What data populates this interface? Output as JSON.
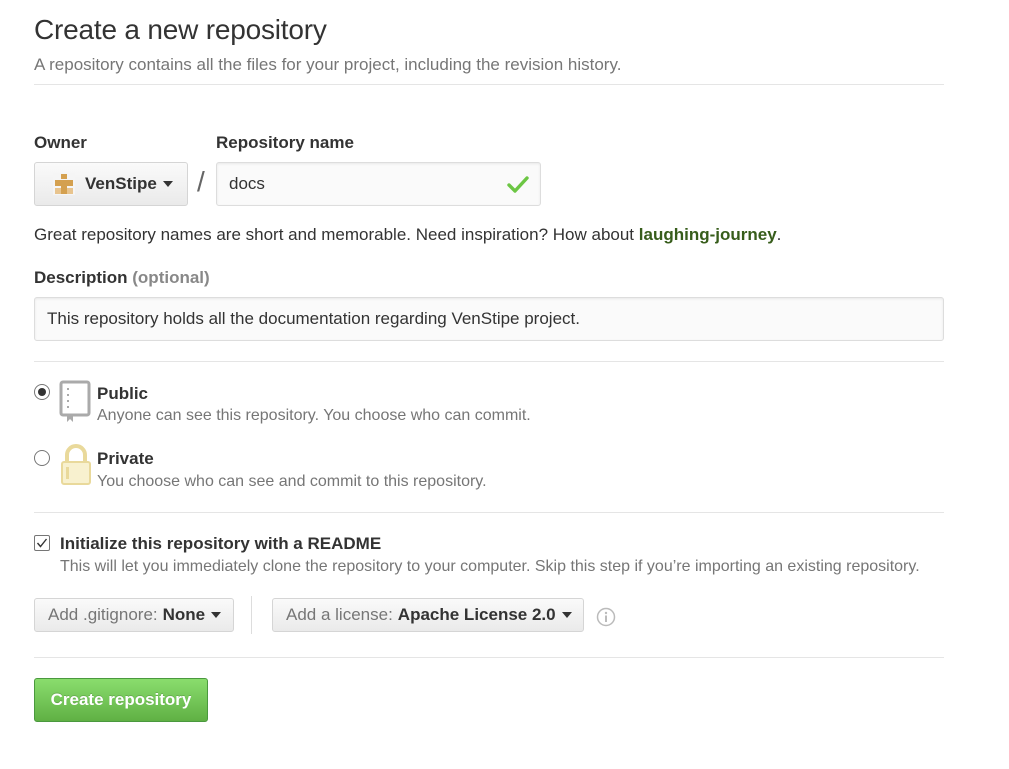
{
  "header": {
    "title": "Create a new repository",
    "subtitle": "A repository contains all the files for your project, including the revision history."
  },
  "owner": {
    "label": "Owner",
    "value": "VenStipe",
    "avatar_icon": "identicon"
  },
  "slash": "/",
  "repo_name": {
    "label": "Repository name",
    "value": "docs",
    "valid_icon": "check-icon",
    "valid_color": "#6cc644"
  },
  "helper": {
    "text": "Great repository names are short and memorable. Need inspiration? How about ",
    "suggestion": "laughing-journey",
    "suffix": ".",
    "suggestion_color": "#375d1b"
  },
  "description": {
    "label": "Description",
    "optional": "(optional)",
    "value": "This repository holds all the documentation regarding VenStipe project."
  },
  "visibility": {
    "selected": "public",
    "public": {
      "title": "Public",
      "desc": "Anyone can see this repository. You choose who can commit.",
      "icon": "repo-book-icon"
    },
    "private": {
      "title": "Private",
      "desc": "You choose who can see and commit to this repository.",
      "icon": "lock-icon"
    }
  },
  "readme": {
    "checked": true,
    "title": "Initialize this repository with a README",
    "desc": "This will let you immediately clone the repository to your computer. Skip this step if you’re importing an existing repository."
  },
  "gitignore": {
    "prefix": "Add .gitignore:",
    "value": "None"
  },
  "license": {
    "prefix": "Add a license:",
    "value": "Apache License 2.0"
  },
  "submit": {
    "label": "Create repository",
    "color": "#60b044"
  }
}
